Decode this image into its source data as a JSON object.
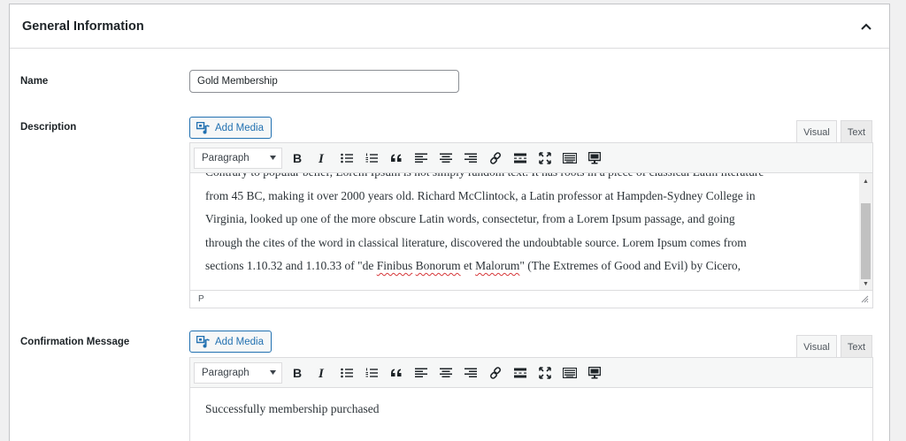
{
  "panel": {
    "title": "General Information"
  },
  "name_field": {
    "label": "Name",
    "value": "Gold Membership"
  },
  "description": {
    "label": "Description",
    "add_media_label": "Add Media",
    "tab_visual": "Visual",
    "tab_text": "Text",
    "format": "Paragraph",
    "lines": [
      "Contrary to popular belief, Lorem Ipsum is not simply random text. It has roots in a piece of classical Latin literature",
      "from 45 BC, making it over 2000 years old. Richard McClintock, a Latin professor at Hampden-Sydney College in",
      "Virginia, looked up one of the more obscure Latin words, consectetur, from a Lorem Ipsum passage, and going",
      "through the cites of the word in classical literature, discovered the undoubtable source. Lorem Ipsum comes from"
    ],
    "last_line_start": "sections 1.10.32 and 1.10.33 of \"de ",
    "last_line_w1": "Finibus",
    "last_line_sp1": " ",
    "last_line_w2": "Bonorum",
    "last_line_mid": " et ",
    "last_line_w3": "Malorum",
    "last_line_end": "\" (The Extremes of Good and Evil) by Cicero,",
    "path": "P"
  },
  "confirmation": {
    "label": "Confirmation Message",
    "add_media_label": "Add Media",
    "tab_visual": "Visual",
    "tab_text": "Text",
    "format": "Paragraph",
    "content": "Successfully membership purchased"
  },
  "colors": {
    "accent": "#2271b1",
    "border": "#dcdcde",
    "toolbar_bg": "#f6f7f7",
    "spell_error": "#d63638"
  }
}
